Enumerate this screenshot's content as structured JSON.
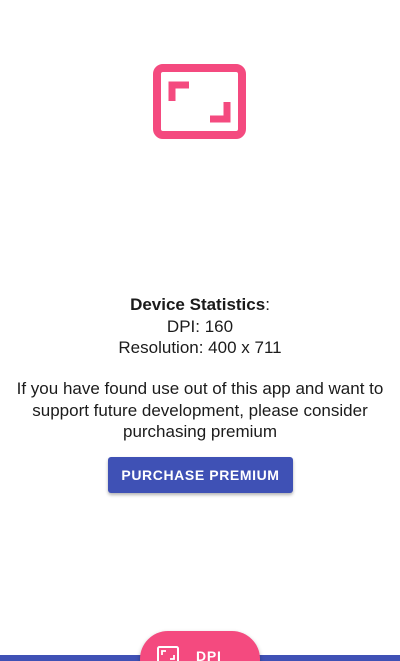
{
  "app": {
    "icon": "fullscreen-corners-icon",
    "accent_color": "#f44a7f",
    "primary_color": "#3f51b5"
  },
  "stats": {
    "title": "Device Statistics",
    "title_suffix": ":",
    "dpi_line": "DPI: 160",
    "resolution_line": "Resolution: 400 x 711"
  },
  "support": {
    "message": "If you have found use out of this app and want to support future development, please consider purchasing premium",
    "purchase_label": "PURCHASE PREMIUM"
  },
  "fab": {
    "icon": "fullscreen-corners-icon",
    "label": "DPI"
  }
}
